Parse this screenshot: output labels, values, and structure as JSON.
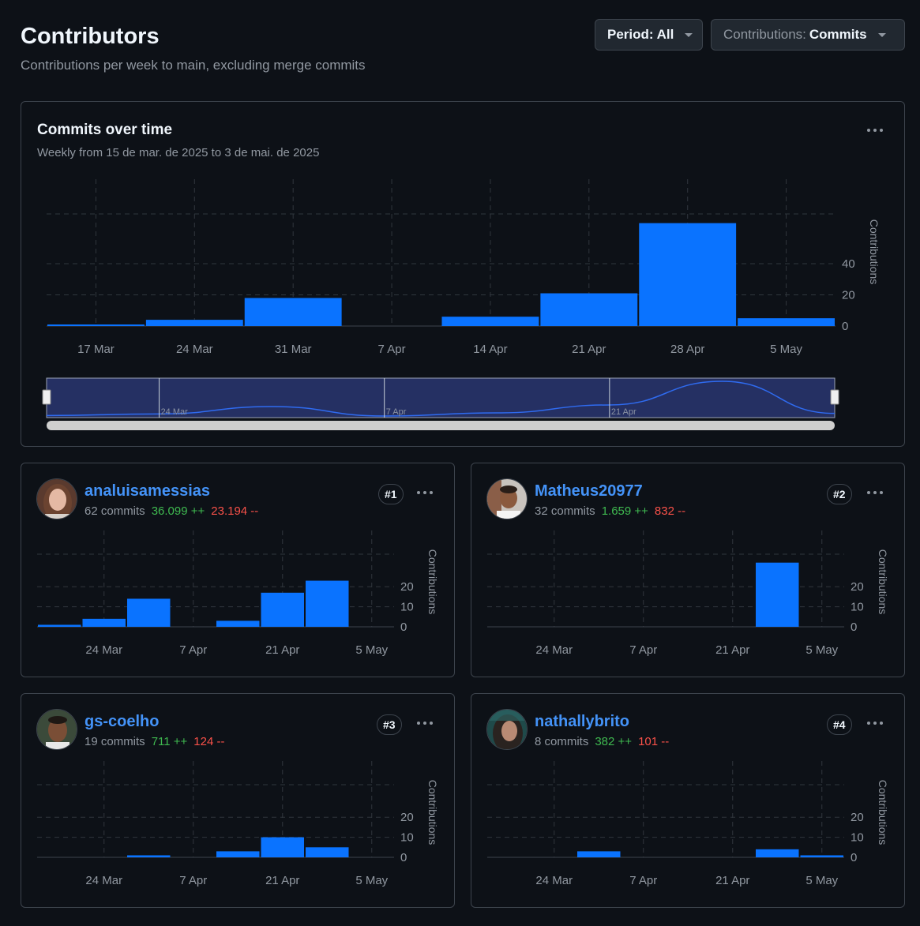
{
  "header": {
    "title": "Contributors",
    "subtitle": "Contributions per week to main, excluding merge commits",
    "period_label": "Period:",
    "period_value": "All",
    "contrib_label": "Contributions:",
    "contrib_value": "Commits"
  },
  "overview": {
    "title": "Commits over time",
    "subtitle": "Weekly from 15 de mar. de 2025 to 3 de mai. de 2025"
  },
  "chart_data": [
    {
      "id": "overview",
      "type": "bar",
      "categories": [
        "17 Mar",
        "24 Mar",
        "31 Mar",
        "7 Apr",
        "14 Apr",
        "21 Apr",
        "28 Apr",
        "5 May"
      ],
      "values": [
        1,
        4,
        18,
        0,
        6,
        21,
        66,
        5
      ],
      "ylabel": "Contributions",
      "yticks": [
        0,
        20,
        40
      ],
      "ylim": [
        0,
        80
      ],
      "color": "#0a73ff",
      "navigator_labels": [
        "24 Mar",
        "7 Apr",
        "21 Apr"
      ]
    },
    {
      "id": "user1",
      "type": "bar",
      "categories": [
        "17 Mar",
        "24 Mar",
        "31 Mar",
        "7 Apr",
        "14 Apr",
        "21 Apr",
        "28 Apr",
        "5 May"
      ],
      "values": [
        1,
        4,
        14,
        0,
        3,
        17,
        23,
        0
      ],
      "xticks": [
        "24 Mar",
        "7 Apr",
        "21 Apr",
        "5 May"
      ],
      "ylabel": "Contributions",
      "yticks": [
        0,
        10,
        20
      ],
      "ylim": [
        0,
        37
      ],
      "color": "#0a73ff"
    },
    {
      "id": "user2",
      "type": "bar",
      "categories": [
        "17 Mar",
        "24 Mar",
        "31 Mar",
        "7 Apr",
        "14 Apr",
        "21 Apr",
        "28 Apr",
        "5 May"
      ],
      "values": [
        0,
        0,
        0,
        0,
        0,
        0,
        32,
        0
      ],
      "xticks": [
        "24 Mar",
        "7 Apr",
        "21 Apr",
        "5 May"
      ],
      "ylabel": "Contributions",
      "yticks": [
        0,
        10,
        20
      ],
      "ylim": [
        0,
        37
      ],
      "color": "#0a73ff"
    },
    {
      "id": "user3",
      "type": "bar",
      "categories": [
        "17 Mar",
        "24 Mar",
        "31 Mar",
        "7 Apr",
        "14 Apr",
        "21 Apr",
        "28 Apr",
        "5 May"
      ],
      "values": [
        0,
        0,
        1,
        0,
        3,
        10,
        5,
        0
      ],
      "xticks": [
        "24 Mar",
        "7 Apr",
        "21 Apr",
        "5 May"
      ],
      "ylabel": "Contributions",
      "yticks": [
        0,
        10,
        20
      ],
      "ylim": [
        0,
        37
      ],
      "color": "#0a73ff"
    },
    {
      "id": "user4",
      "type": "bar",
      "categories": [
        "17 Mar",
        "24 Mar",
        "31 Mar",
        "7 Apr",
        "14 Apr",
        "21 Apr",
        "28 Apr",
        "5 May"
      ],
      "values": [
        0,
        0,
        3,
        0,
        0,
        0,
        4,
        1
      ],
      "xticks": [
        "24 Mar",
        "7 Apr",
        "21 Apr",
        "5 May"
      ],
      "ylabel": "Contributions",
      "yticks": [
        0,
        10,
        20
      ],
      "ylim": [
        0,
        37
      ],
      "color": "#0a73ff"
    }
  ],
  "contributors": [
    {
      "name": "analuisamessias",
      "commits": "62 commits",
      "additions": "36.099 ++",
      "deletions": "23.194 --",
      "rank": "#1"
    },
    {
      "name": "Matheus20977",
      "commits": "32 commits",
      "additions": "1.659 ++",
      "deletions": "832 --",
      "rank": "#2"
    },
    {
      "name": "gs-coelho",
      "commits": "19 commits",
      "additions": "711 ++",
      "deletions": "124 --",
      "rank": "#3"
    },
    {
      "name": "nathallybrito",
      "commits": "8 commits",
      "additions": "382 ++",
      "deletions": "101 --",
      "rank": "#4"
    }
  ]
}
